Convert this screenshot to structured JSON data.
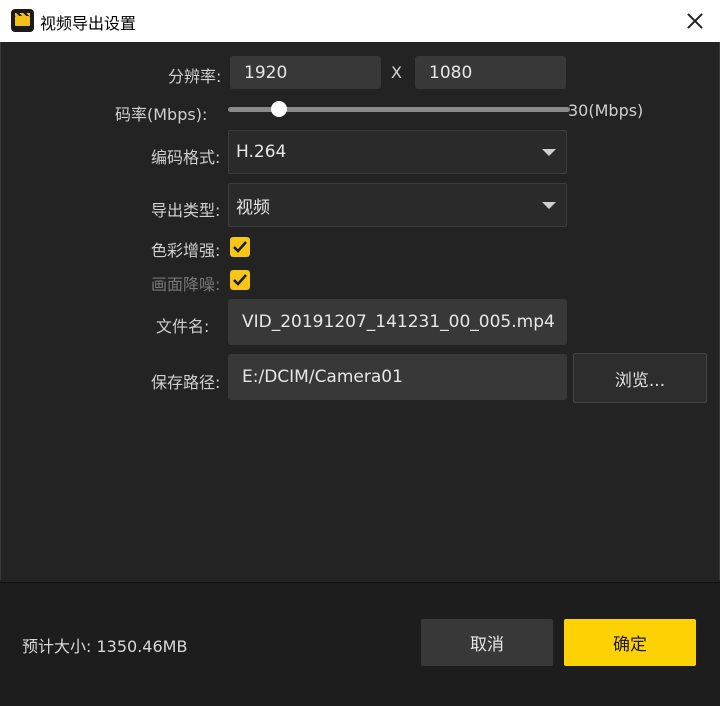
{
  "window": {
    "title": "视频导出设置"
  },
  "resolution": {
    "label": "分辨率:",
    "width": "1920",
    "separator": "X",
    "height": "1080"
  },
  "bitrate": {
    "label": "码率(Mbps):",
    "max_label": "30(Mbps)",
    "value_fraction": 0.15
  },
  "codec": {
    "label": "编码格式:",
    "selected": "H.264"
  },
  "export_type": {
    "label": "导出类型:",
    "selected": "视频"
  },
  "color_enhance": {
    "label": "色彩增强:",
    "checked": true
  },
  "denoise": {
    "label": "画面降噪:",
    "checked": true
  },
  "filename": {
    "label": "文件名:",
    "value": "VID_20191207_141231_00_005.mp4"
  },
  "save_path": {
    "label": "保存路径:",
    "value": "E:/DCIM/Camera01",
    "browse_label": "浏览..."
  },
  "footer": {
    "size_text": "预计大小:  1350.46MB",
    "cancel_label": "取消",
    "ok_label": "确定"
  },
  "colors": {
    "accent": "#fdd205",
    "background": "#232323"
  }
}
